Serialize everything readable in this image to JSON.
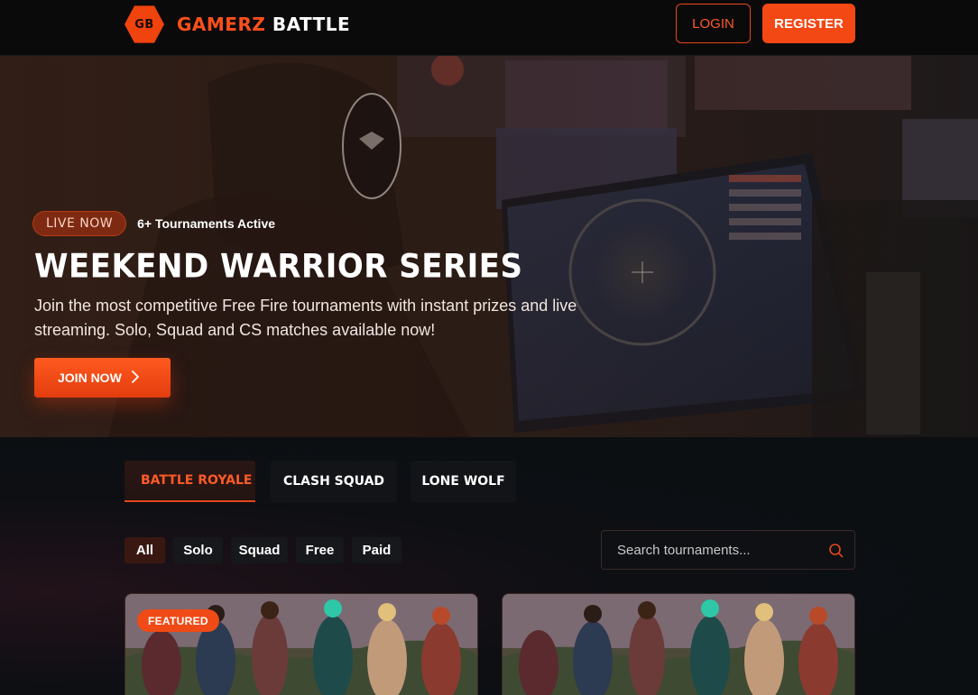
{
  "brand": {
    "logo_initials": "GB",
    "name_part1": "GAMERZ",
    "name_part2": "BATTLE",
    "accent_color": "#f34714"
  },
  "nav": {
    "login_label": "LOGIN",
    "register_label": "REGISTER"
  },
  "hero": {
    "live_badge": "LIVE NOW",
    "live_count": "6+ Tournaments Active",
    "title": "WEEKEND WARRIOR SERIES",
    "description": "Join the most competitive Free Fire tournaments with instant prizes and live streaming. Solo, Squad and CS matches available now!",
    "join_label": "JOIN NOW",
    "join_icon": "chevron-right-icon"
  },
  "tabs": [
    {
      "label": "BATTLE ROYALE",
      "active": true
    },
    {
      "label": "CLASH SQUAD",
      "active": false
    },
    {
      "label": "LONE WOLF",
      "active": false
    }
  ],
  "filters": [
    {
      "label": "All",
      "active": true
    },
    {
      "label": "Solo",
      "active": false
    },
    {
      "label": "Squad",
      "active": false
    },
    {
      "label": "Free",
      "active": false
    },
    {
      "label": "Paid",
      "active": false
    }
  ],
  "search": {
    "placeholder": "Search tournaments...",
    "icon": "search-icon"
  },
  "cards": [
    {
      "badge": "FEATURED"
    },
    {
      "badge": ""
    }
  ]
}
